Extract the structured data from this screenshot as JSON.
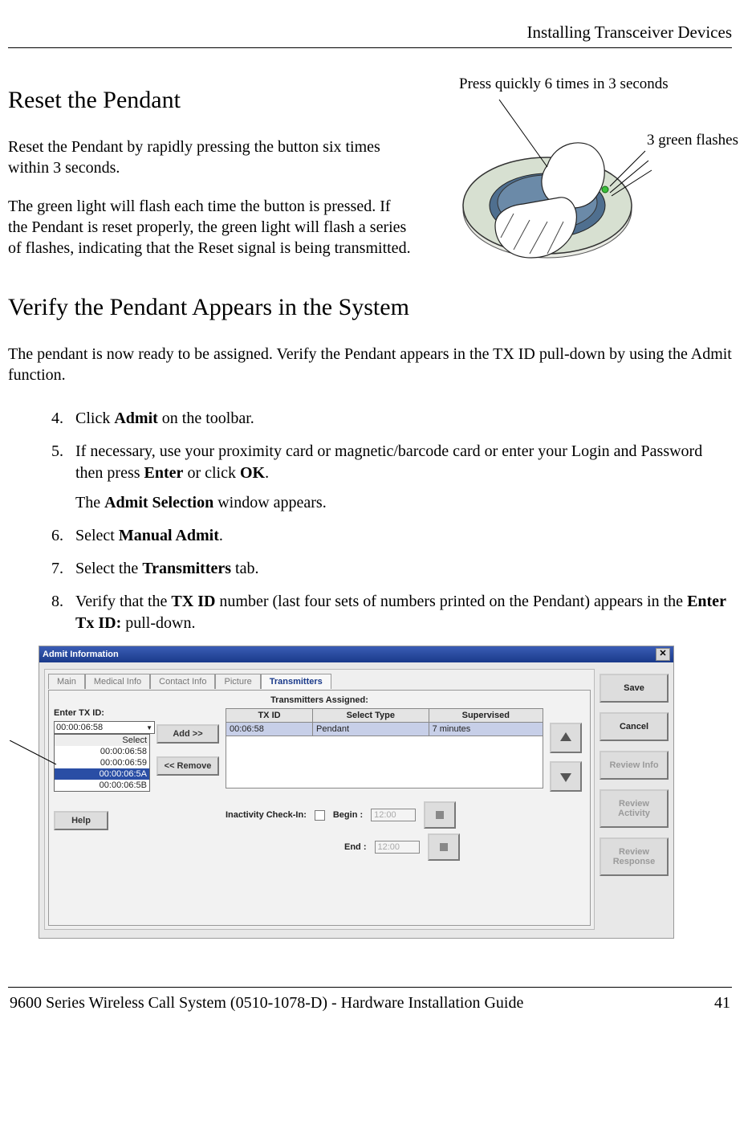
{
  "header": {
    "running": "Installing Transceiver Devices"
  },
  "section1": {
    "title": "Reset the Pendant",
    "p1": "Reset the Pendant by rapidly pressing the button six times within 3 seconds.",
    "p2": "The green light will flash each time the button is pressed. If the Pendant is reset properly, the green light will flash a series of flashes, indicating that the Reset signal is being transmitted.",
    "annotation_top": "Press quickly 6 times in 3 seconds",
    "annotation_side": "3 green flashes"
  },
  "section2": {
    "title": "Verify the Pendant Appears in the System",
    "intro": "The pendant is now ready to be assigned. Verify the Pendant appears in the TX ID pull-down by using the Admit function."
  },
  "steps": {
    "s4": "Click <b>Admit</b> on the toolbar.",
    "s5": "If necessary, use your proximity card or magnetic/barcode card or enter your Login and Password then press <b>Enter</b> or click <b>OK</b>.",
    "s5b": "The <b>Admit Selection</b> window appears.",
    "s6": "Select <b>Manual Admit</b>.",
    "s7": "Select the <b>Transmitters</b> tab.",
    "s8": "Verify that the <b>TX ID</b> number (last four sets of numbers printed on the Pendant) appears in the <b>Enter Tx ID:</b> pull-down."
  },
  "admit": {
    "title": "Admit Information",
    "tabs": {
      "main": "Main",
      "medical": "Medical Info",
      "contact": "Contact Info",
      "picture": "Picture",
      "transmitters": "Transmitters"
    },
    "assigned_label": "Transmitters Assigned:",
    "enter_label": "Enter TX ID:",
    "selected_tx": "00:00:06:58",
    "options_hdr": "Select",
    "options": [
      "00:00:06:58",
      "00:00:06:59",
      "00:00:06:5A",
      "00:00:06:5B"
    ],
    "add": "Add >>",
    "remove": "<< Remove",
    "th_txid": "TX ID",
    "th_type": "Select Type",
    "th_sup": "Supervised",
    "row_txid": "00:06:58",
    "row_type": "Pendant",
    "row_sup": "7 minutes",
    "inact": "Inactivity Check-In:",
    "begin": "Begin :",
    "end": "End :",
    "time": "12:00",
    "help": "Help",
    "side": {
      "save": "Save",
      "cancel": "Cancel",
      "rinfo": "Review Info",
      "ract": "Review Activity",
      "rresp": "Review Response"
    }
  },
  "footer": {
    "left": "9600 Series Wireless Call System (0510-1078-D) - Hardware Installation Guide",
    "right": "41"
  }
}
